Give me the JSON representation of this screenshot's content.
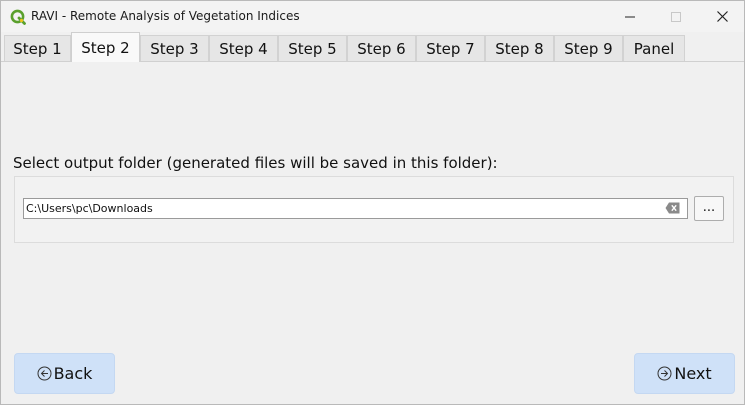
{
  "window": {
    "title": "RAVI - Remote Analysis of Vegetation Indices",
    "controls": {
      "minimize_icon": "minimize-icon",
      "maximize_icon": "maximize-icon",
      "close_icon": "close-icon"
    }
  },
  "tabs": [
    {
      "label": "Step 1",
      "active": false
    },
    {
      "label": "Step 2",
      "active": true
    },
    {
      "label": "Step 3",
      "active": false
    },
    {
      "label": "Step 4",
      "active": false
    },
    {
      "label": "Step 5",
      "active": false
    },
    {
      "label": "Step 6",
      "active": false
    },
    {
      "label": "Step 7",
      "active": false
    },
    {
      "label": "Step 8",
      "active": false
    },
    {
      "label": "Step 9",
      "active": false
    },
    {
      "label": "Panel",
      "active": false
    }
  ],
  "output_folder": {
    "label": "Select output folder (generated files will be saved in this folder):",
    "path_value": "C:\\Users\\pc\\Downloads",
    "browse_label": "..."
  },
  "navigation": {
    "back_label": "Back",
    "next_label": "Next"
  },
  "colors": {
    "accent_button": "#cfe1f8",
    "qgis_green": "#5aa02c",
    "qgis_yellow": "#f0c419"
  }
}
